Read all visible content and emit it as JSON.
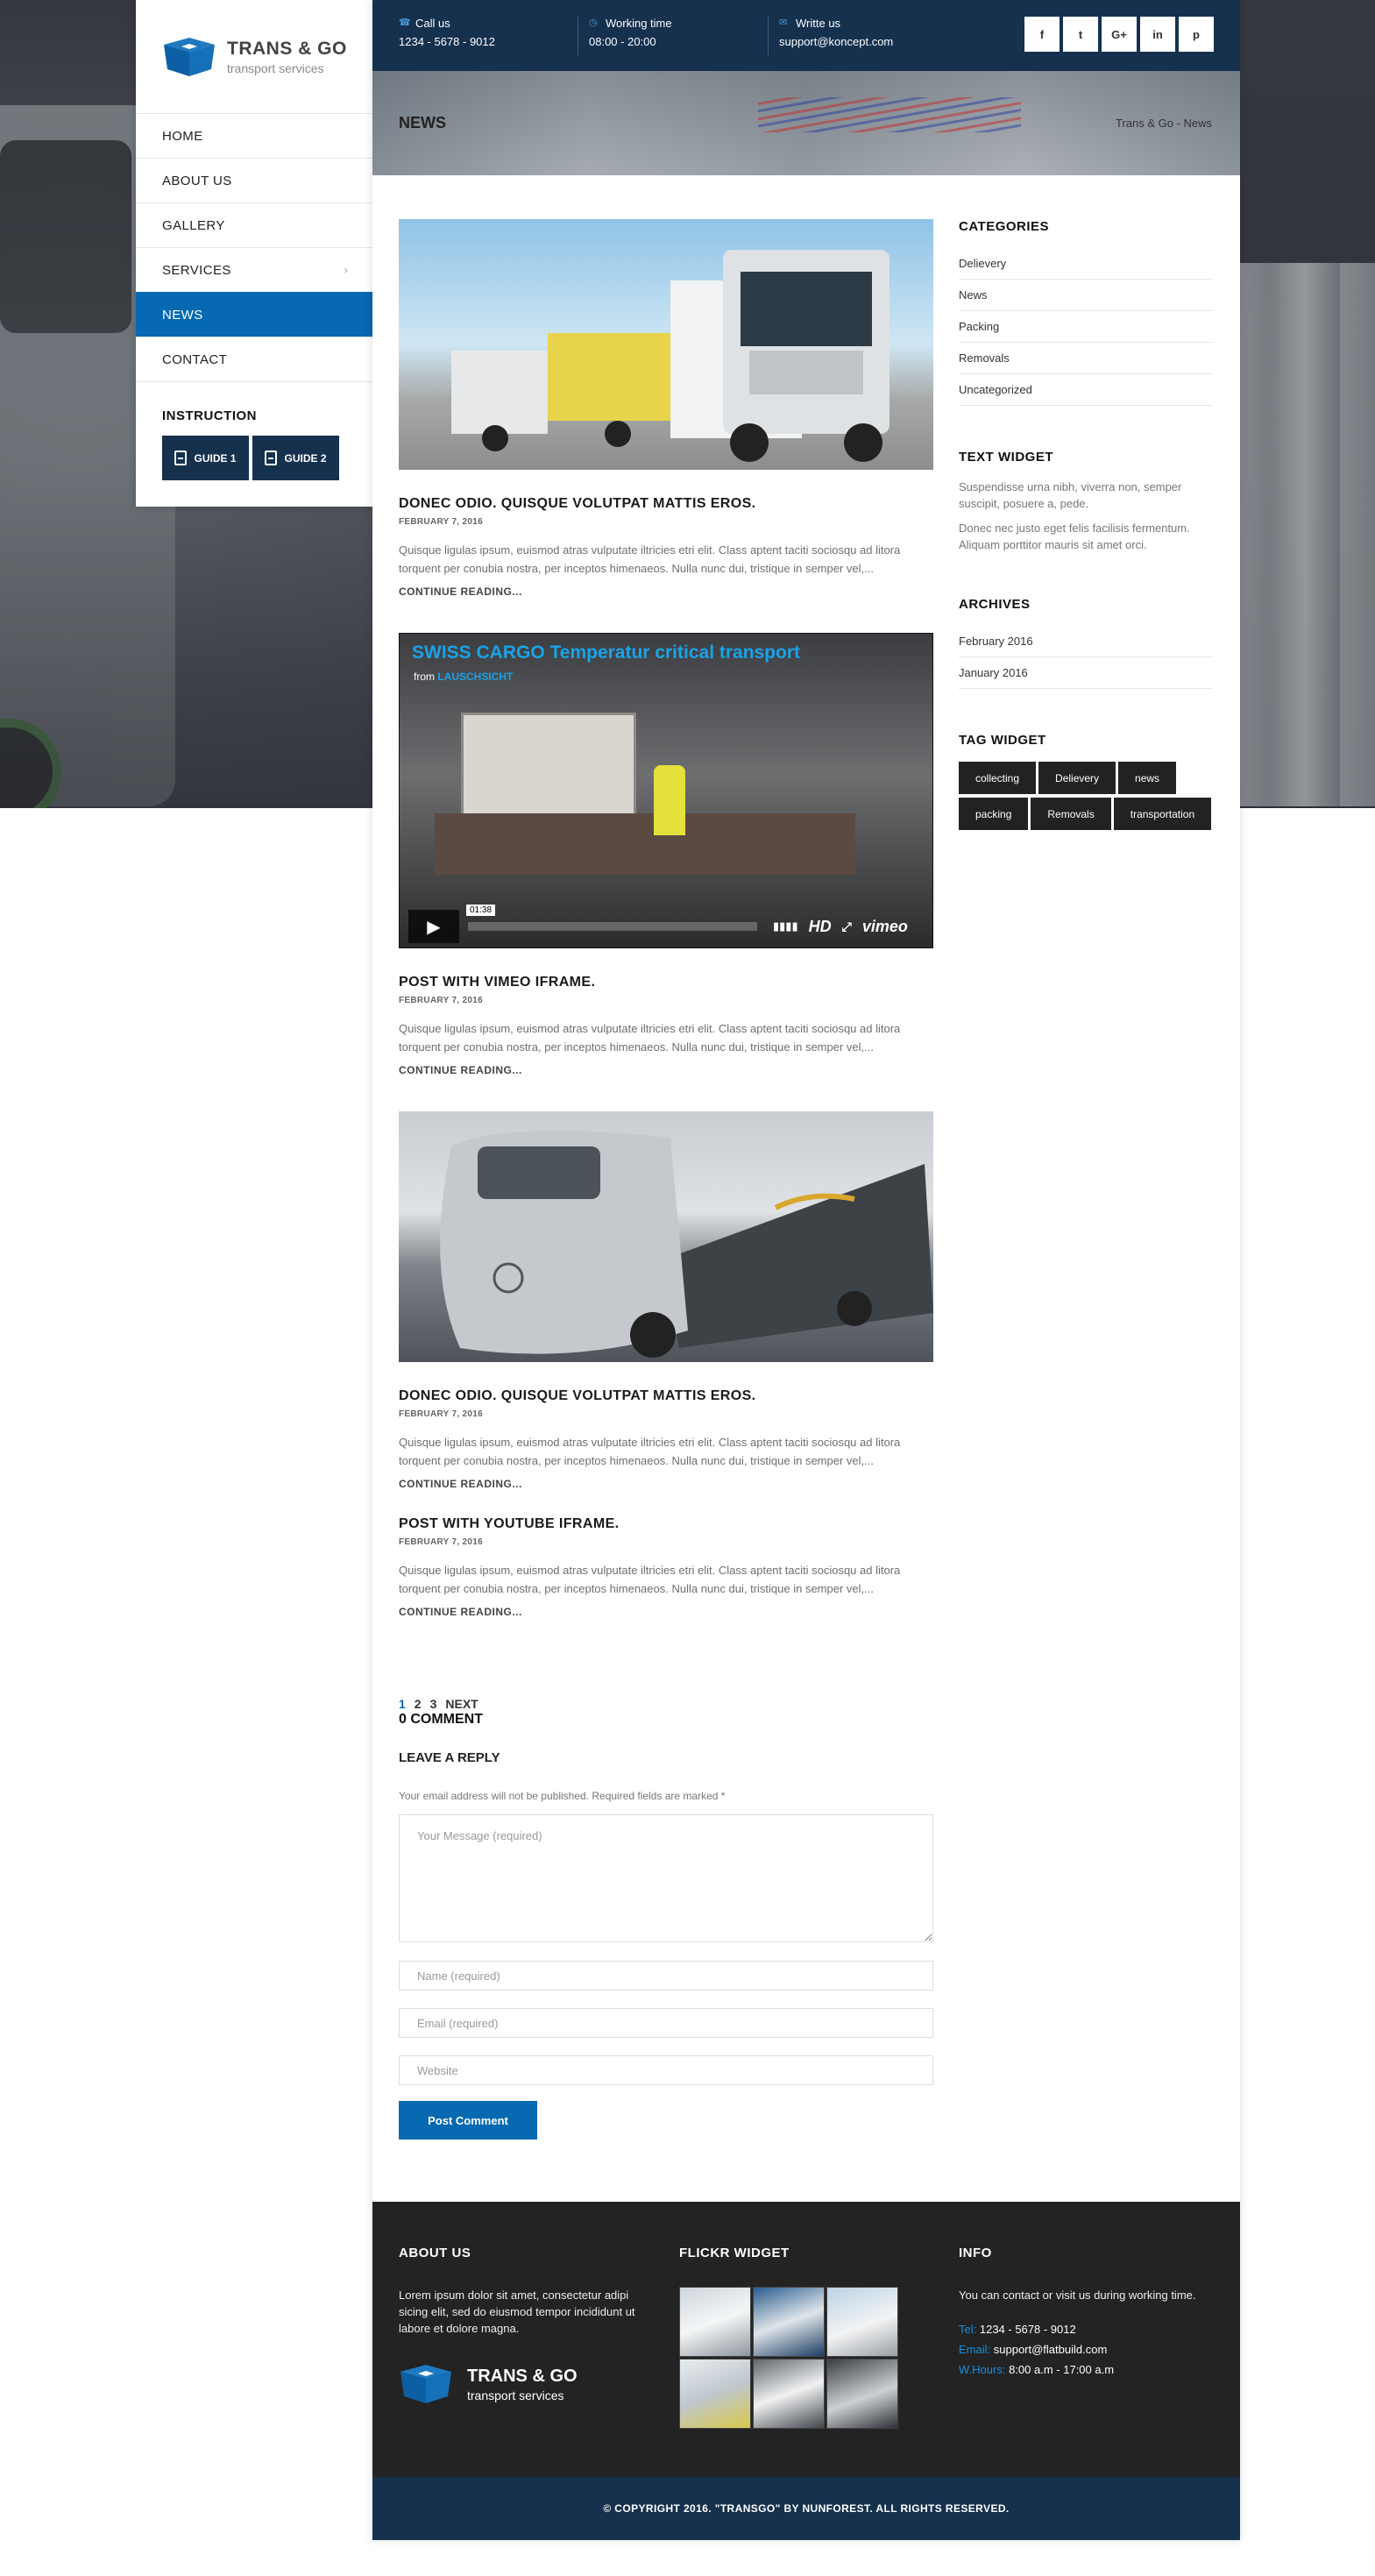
{
  "brand": {
    "title": "TRANS & GO",
    "subtitle": "transport services",
    "accent_color": "#0669b2",
    "navy_color": "#15314e"
  },
  "nav": {
    "items": [
      {
        "label": "HOME"
      },
      {
        "label": "ABOUT US"
      },
      {
        "label": "GALLERY"
      },
      {
        "label": "SERVICES",
        "chevron": "›"
      },
      {
        "label": "NEWS"
      },
      {
        "label": "CONTACT"
      }
    ]
  },
  "instruction": {
    "title": "INSTRUCTION",
    "guide1": "GUIDE 1",
    "guide2": "GUIDE 2"
  },
  "topbar": {
    "call_label": "Call us",
    "call_value": "1234 - 5678 - 9012",
    "time_label": "Working time",
    "time_value": "08:00 - 20:00",
    "write_label": "Writte us",
    "write_value": "support@koncept.com",
    "socials": [
      "f",
      "t",
      "G+",
      "in",
      "p"
    ]
  },
  "page": {
    "title": "NEWS",
    "breadcrumb": "Trans & Go - News"
  },
  "posts": [
    {
      "title": "DONEC ODIO. QUISQUE VOLUTPAT MATTIS EROS.",
      "date": "FEBRUARY 7, 2016",
      "excerpt": "Quisque ligulas ipsum, euismod atras vulputate iltricies etri elit. Class aptent taciti sociosqu ad litora torquent per conubia nostra, per inceptos himenaeos. Nulla nunc dui, tristique in semper vel,...",
      "read_more": "CONTINUE READING..."
    },
    {
      "title": "POST WITH VIMEO IFRAME.",
      "date": "FEBRUARY 7, 2016",
      "excerpt": "Quisque ligulas ipsum, euismod atras vulputate iltricies etri elit. Class aptent taciti sociosqu ad litora torquent per conubia nostra, per inceptos himenaeos. Nulla nunc dui, tristique in semper vel,...",
      "read_more": "CONTINUE READING...",
      "video": {
        "title": "SWISS CARGO Temperatur critical transport",
        "from": "from",
        "author": "LAUSCHSICHT",
        "time": "01:38",
        "hd": "HD",
        "provider": "vimeo"
      }
    },
    {
      "title": "DONEC ODIO. QUISQUE VOLUTPAT MATTIS EROS.",
      "date": "FEBRUARY 7, 2016",
      "excerpt": "Quisque ligulas ipsum, euismod atras vulputate iltricies etri elit. Class aptent taciti sociosqu ad litora torquent per conubia nostra, per inceptos himenaeos. Nulla nunc dui, tristique in semper vel,...",
      "read_more": "CONTINUE READING..."
    },
    {
      "title": "POST WITH YOUTUBE IFRAME.",
      "date": "FEBRUARY 7, 2016",
      "excerpt": "Quisque ligulas ipsum, euismod atras vulputate iltricies etri elit. Class aptent taciti sociosqu ad litora torquent per conubia nostra, per inceptos himenaeos. Nulla nunc dui, tristique in semper vel,...",
      "read_more": "CONTINUE READING..."
    }
  ],
  "pagination": {
    "p1": "1",
    "p2": "2",
    "p3": "3",
    "next": "NEXT"
  },
  "comments": {
    "count": "0 COMMENT",
    "reply_title": "LEAVE A REPLY",
    "note": "Your email address will not be published. Required fields are marked *",
    "message_placeholder": "Your Message (required)",
    "name_placeholder": "Name (required)",
    "email_placeholder": "Email (required)",
    "website_placeholder": "Website",
    "submit": "Post Comment"
  },
  "sidebar_widgets": {
    "categories_title": "CATEGORIES",
    "categories": [
      "Delievery",
      "News",
      "Packing",
      "Removals",
      "Uncategorized"
    ],
    "text_title": "TEXT WIDGET",
    "text_p1": "Suspendisse urna nibh, viverra non, semper suscipit, posuere a, pede.",
    "text_p2": "Donec nec justo eget felis facilisis fermentum. Aliquam porttitor mauris sit amet orci.",
    "archives_title": "ARCHIVES",
    "archives": [
      "February 2016",
      "January 2016"
    ],
    "tags_title": "TAG WIDGET",
    "tags": [
      "collecting",
      "Delievery",
      "news",
      "packing",
      "Removals",
      "transportation"
    ]
  },
  "footer": {
    "about_title": "ABOUT US",
    "about_text": "Lorem ipsum dolor sit amet, consectetur adipi sicing elit, sed do eiusmod tempor incididunt ut labore et dolore magna.",
    "flickr_title": "FLICKR WIDGET",
    "info_title": "INFO",
    "info_text": "You can contact or visit us during working time.",
    "tel_label": "Tel:",
    "tel_value": "1234 - 5678 - 9012",
    "email_label": "Email:",
    "email_value": "support@flatbuild.com",
    "hours_label": "W.Hours:",
    "hours_value": "8:00 a.m - 17:00 a.m",
    "copyright": "© COPYRIGHT 2016. \"TRANSGO\" BY NUNFOREST. ALL RIGHTS RESERVED."
  }
}
